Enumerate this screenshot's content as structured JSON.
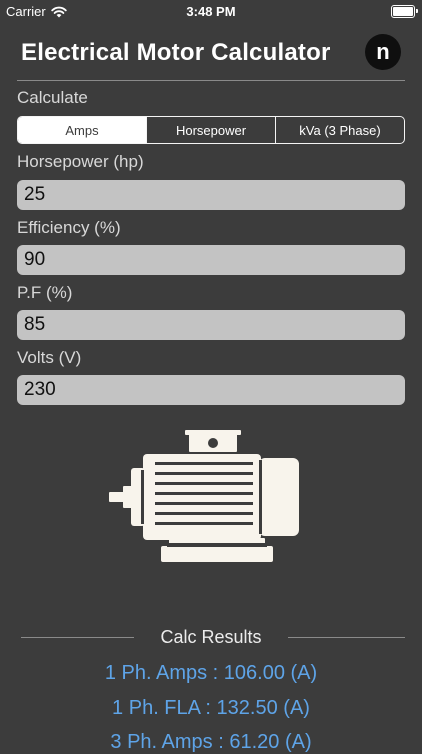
{
  "status_bar": {
    "carrier": "Carrier",
    "time": "3:48 PM"
  },
  "header": {
    "title": "Electrical Motor Calculator",
    "logo_letter": "n"
  },
  "calculate": {
    "label": "Calculate",
    "segments": [
      "Amps",
      "Horsepower",
      "kVa (3 Phase)"
    ],
    "selected": "Amps"
  },
  "fields": {
    "horsepower": {
      "label": "Horsepower (hp)",
      "value": "25"
    },
    "efficiency": {
      "label": "Efficiency (%)",
      "value": "90"
    },
    "pf": {
      "label": "P.F (%)",
      "value": "85"
    },
    "volts": {
      "label": "Volts (V)",
      "value": "230"
    }
  },
  "results": {
    "title": "Calc Results",
    "lines": [
      "1 Ph. Amps : 106.00 (A)",
      "1 Ph. FLA : 132.50 (A)",
      "3 Ph. Amps : 61.20 (A)"
    ]
  },
  "colors": {
    "background": "#3c3c3c",
    "result_text": "#5ea4e8",
    "field_bg": "#c3c3c3"
  },
  "icons": {
    "motor": "electric-motor-icon",
    "wifi": "wifi-icon",
    "battery": "battery-icon"
  }
}
